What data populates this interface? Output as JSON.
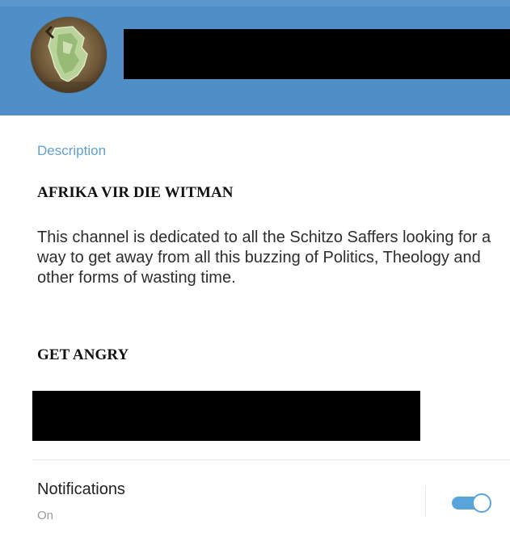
{
  "header": {
    "channel_name_redacted": true,
    "avatar_icon": "channel-avatar-icon"
  },
  "info": {
    "description_label": "Description",
    "title_line": "AFRIKA VIR DIE WITMAN",
    "body": "This channel is dedicated to all the Schitzo Saffers looking for a way to get away from all this buzzing of Politics, Theology and other forms of wasting time.",
    "closing_line": "GET ANGRY",
    "link_redacted": true
  },
  "notifications": {
    "label": "Notifications",
    "status": "On",
    "enabled": true
  },
  "colors": {
    "header_blue": "#4f8ec6",
    "accent_blue": "#5ea1d3",
    "toggle_blue": "#5aa4dc"
  }
}
